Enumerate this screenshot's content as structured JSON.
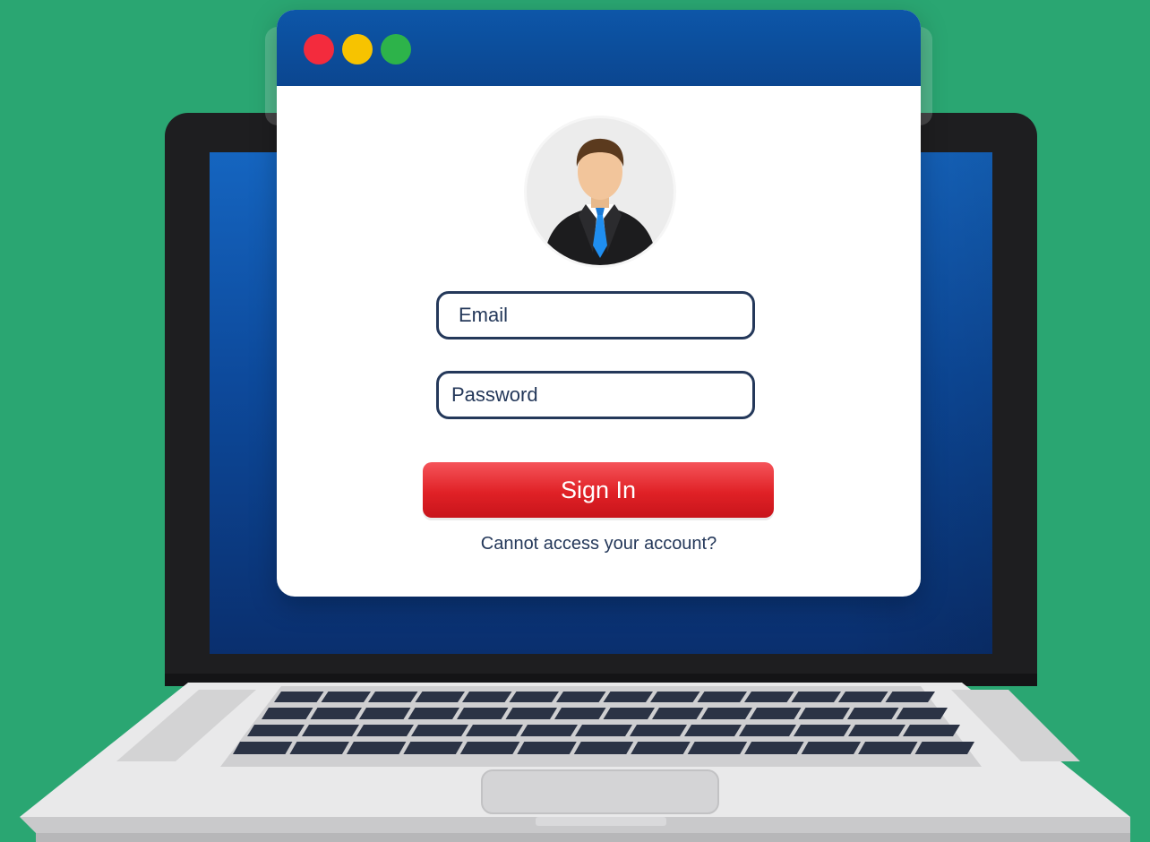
{
  "window": {
    "controls": [
      {
        "name": "close",
        "color": "#f32b3d"
      },
      {
        "name": "minimize",
        "color": "#f7c300"
      },
      {
        "name": "maximize",
        "color": "#2db34a"
      }
    ]
  },
  "login_form": {
    "avatar_icon": "user-avatar-icon",
    "email_placeholder": "Email",
    "password_placeholder": "Password",
    "submit_label": "Sign In",
    "help_link": "Cannot access your account?"
  },
  "colors": {
    "background": "#2aa672",
    "titlebar": "#0d56a8",
    "button": "#e02126",
    "field_border": "#24385a"
  }
}
